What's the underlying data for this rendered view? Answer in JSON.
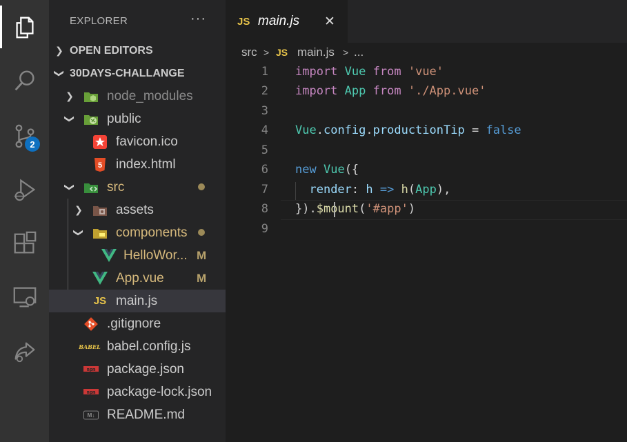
{
  "activity_bar": {
    "items": [
      {
        "name": "explorer",
        "icon": "files-icon",
        "active": true
      },
      {
        "name": "search",
        "icon": "search-icon"
      },
      {
        "name": "source-control",
        "icon": "source-control-icon",
        "badge": "2"
      },
      {
        "name": "run-debug",
        "icon": "run-debug-icon"
      },
      {
        "name": "extensions",
        "icon": "extensions-icon"
      },
      {
        "name": "remote-explorer",
        "icon": "remote-explorer-icon"
      },
      {
        "name": "live-share",
        "icon": "live-share-icon"
      }
    ]
  },
  "sidebar": {
    "title": "EXPLORER",
    "more": "···",
    "open_editors": "OPEN EDITORS",
    "project": "30DAYS-CHALLANGE",
    "tree": [
      {
        "label": "node_modules",
        "icon": "folder-node-icon",
        "icon_color": "#8bc34a",
        "expandable": "collapsed"
      },
      {
        "label": "public",
        "icon": "folder-public-icon",
        "icon_color": "#8bc34a",
        "expandable": "expanded"
      },
      {
        "label": "favicon.ico",
        "icon": "favicon-icon",
        "icon_color": "#f44336"
      },
      {
        "label": "index.html",
        "icon": "html-icon",
        "icon_color": "#e44d26",
        "glyph": "5"
      },
      {
        "label": "src",
        "icon": "folder-src-icon",
        "icon_color": "#4caf50",
        "expandable": "expanded",
        "status": "dot"
      },
      {
        "label": "assets",
        "icon": "folder-assets-icon",
        "icon_color": "#e57373",
        "expandable": "collapsed"
      },
      {
        "label": "components",
        "icon": "folder-components-icon",
        "icon_color": "#e8c44a",
        "expandable": "expanded",
        "status": "dot"
      },
      {
        "label": "HelloWor...",
        "icon": "vue-icon",
        "icon_color": "#41b883",
        "glyph": "V",
        "status": "M"
      },
      {
        "label": "App.vue",
        "icon": "vue-icon",
        "icon_color": "#41b883",
        "glyph": "V",
        "status": "M"
      },
      {
        "label": "main.js",
        "icon": "js-icon",
        "icon_color": "#e8c44a",
        "glyph": "JS",
        "selected": true
      },
      {
        "label": ".gitignore",
        "icon": "git-icon",
        "icon_color": "#e44d26"
      },
      {
        "label": "babel.config.js",
        "icon": "babel-icon",
        "icon_color": "#e8c44a",
        "glyph": "BABEL"
      },
      {
        "label": "package.json",
        "icon": "npm-icon",
        "icon_color": "#cb3837",
        "glyph": "npm"
      },
      {
        "label": "package-lock.json",
        "icon": "npm-icon",
        "icon_color": "#cb3837",
        "glyph": "npm"
      },
      {
        "label": "README.md",
        "icon": "markdown-icon",
        "icon_color": "#8a8a8a",
        "glyph": "M↓"
      }
    ]
  },
  "editor": {
    "tab": {
      "lang": "JS",
      "name": "main.js",
      "close": "✕"
    },
    "breadcrumbs": {
      "folder": "src",
      "sep": ">",
      "lang": "JS",
      "file": "main.js",
      "more": "..."
    },
    "line_numbers": [
      "1",
      "2",
      "3",
      "4",
      "5",
      "6",
      "7",
      "8",
      "9"
    ],
    "tokens": {
      "import": "import",
      "from": "from",
      "vue_id": "Vue",
      "vue_str": "'vue'",
      "app_id": "App",
      "app_str": "'./App.vue'",
      "config": "config",
      "productionTip": "productionTip",
      "false": "false",
      "new": "new",
      "render": "render",
      "h": "h",
      "arrow": "=>",
      "mount": "$mount",
      "app_sel": "'#app'"
    }
  },
  "colors": {
    "keyword": "#569cd6",
    "class": "#4ec9b0",
    "string": "#ce9178",
    "property": "#9cdcfe",
    "function": "#dcdcaa",
    "badge": "#0e70c0"
  }
}
